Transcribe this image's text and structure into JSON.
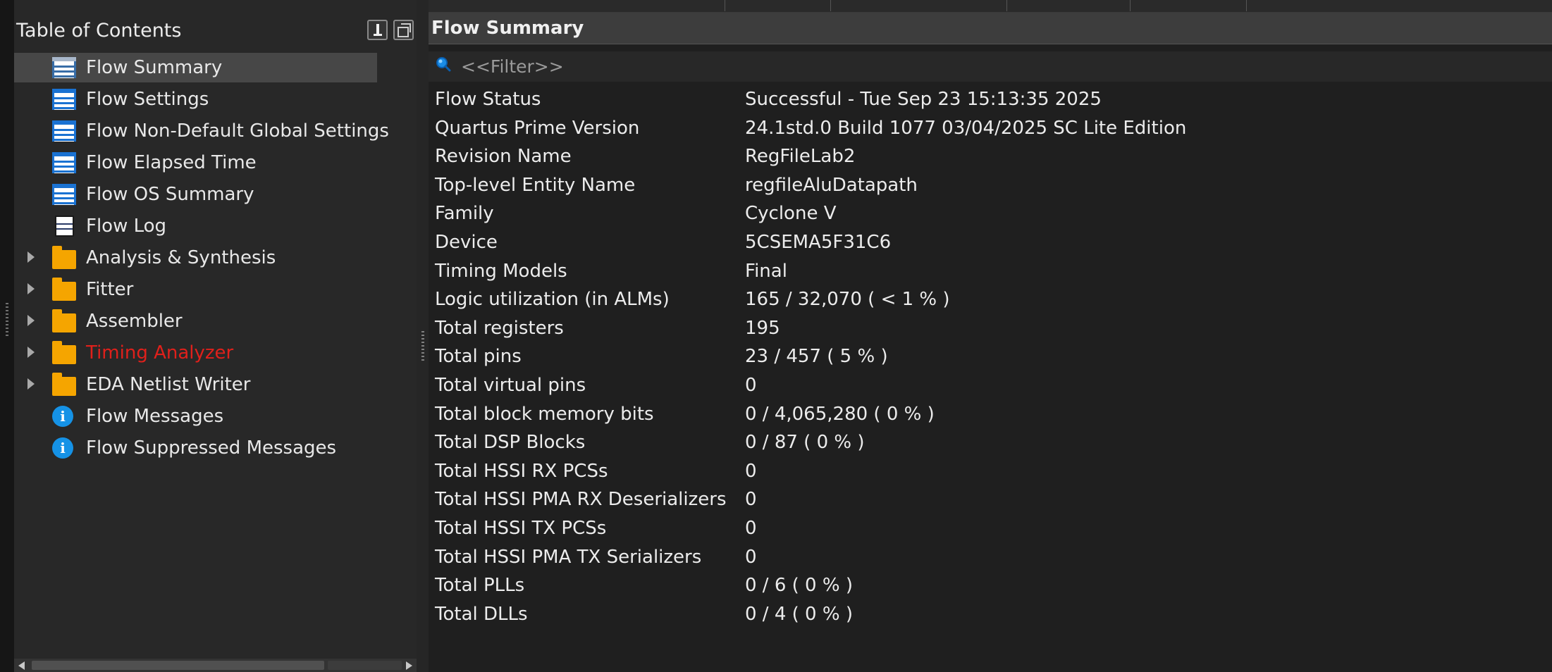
{
  "toc": {
    "title": "Table of Contents",
    "items": [
      {
        "label": "Flow Summary",
        "icon": "table-icon",
        "selected": true,
        "expandable": false,
        "red": false
      },
      {
        "label": "Flow Settings",
        "icon": "table-icon",
        "selected": false,
        "expandable": false,
        "red": false
      },
      {
        "label": "Flow Non-Default Global Settings",
        "icon": "table-icon",
        "selected": false,
        "expandable": false,
        "red": false
      },
      {
        "label": "Flow Elapsed Time",
        "icon": "table-icon",
        "selected": false,
        "expandable": false,
        "red": false
      },
      {
        "label": "Flow OS Summary",
        "icon": "table-icon",
        "selected": false,
        "expandable": false,
        "red": false
      },
      {
        "label": "Flow Log",
        "icon": "log-icon",
        "selected": false,
        "expandable": false,
        "red": false
      },
      {
        "label": "Analysis & Synthesis",
        "icon": "folder-icon",
        "selected": false,
        "expandable": true,
        "red": false
      },
      {
        "label": "Fitter",
        "icon": "folder-icon",
        "selected": false,
        "expandable": true,
        "red": false
      },
      {
        "label": "Assembler",
        "icon": "folder-icon",
        "selected": false,
        "expandable": true,
        "red": false
      },
      {
        "label": "Timing Analyzer",
        "icon": "folder-icon",
        "selected": false,
        "expandable": true,
        "red": true
      },
      {
        "label": "EDA Netlist Writer",
        "icon": "folder-icon",
        "selected": false,
        "expandable": true,
        "red": false
      },
      {
        "label": "Flow Messages",
        "icon": "info-icon",
        "selected": false,
        "expandable": false,
        "red": false
      },
      {
        "label": "Flow Suppressed Messages",
        "icon": "info-icon",
        "selected": false,
        "expandable": false,
        "red": false
      }
    ]
  },
  "report": {
    "title": "Flow Summary",
    "filter_placeholder": "<<Filter>>",
    "rows": [
      {
        "key": "Flow Status",
        "value": "Successful - Tue Sep 23 15:13:35 2025"
      },
      {
        "key": "Quartus Prime Version",
        "value": "24.1std.0 Build 1077 03/04/2025 SC Lite Edition"
      },
      {
        "key": "Revision Name",
        "value": "RegFileLab2"
      },
      {
        "key": "Top-level Entity Name",
        "value": "regfileAluDatapath"
      },
      {
        "key": "Family",
        "value": "Cyclone V"
      },
      {
        "key": "Device",
        "value": "5CSEMA5F31C6"
      },
      {
        "key": "Timing Models",
        "value": "Final"
      },
      {
        "key": "Logic utilization (in ALMs)",
        "value": "165 / 32,070 ( < 1 % )"
      },
      {
        "key": "Total registers",
        "value": "195"
      },
      {
        "key": "Total pins",
        "value": "23 / 457 ( 5 % )"
      },
      {
        "key": "Total virtual pins",
        "value": "0"
      },
      {
        "key": "Total block memory bits",
        "value": "0 / 4,065,280 ( 0 % )"
      },
      {
        "key": "Total DSP Blocks",
        "value": "0 / 87 ( 0 % )"
      },
      {
        "key": "Total HSSI RX PCSs",
        "value": "0"
      },
      {
        "key": "Total HSSI PMA RX Deserializers",
        "value": "0"
      },
      {
        "key": "Total HSSI TX PCSs",
        "value": "0"
      },
      {
        "key": "Total HSSI PMA TX Serializers",
        "value": "0"
      },
      {
        "key": "Total PLLs",
        "value": "0 / 6 ( 0 % )"
      },
      {
        "key": "Total DLLs",
        "value": "0 / 4 ( 0 % )"
      }
    ]
  },
  "colors": {
    "background": "#1e1e1e",
    "panel": "#282828",
    "selected_row": "#474747",
    "accent_blue": "#1a72d2",
    "folder": "#f5a500",
    "warning_red": "#e0201b",
    "info_blue": "#1592e6"
  }
}
